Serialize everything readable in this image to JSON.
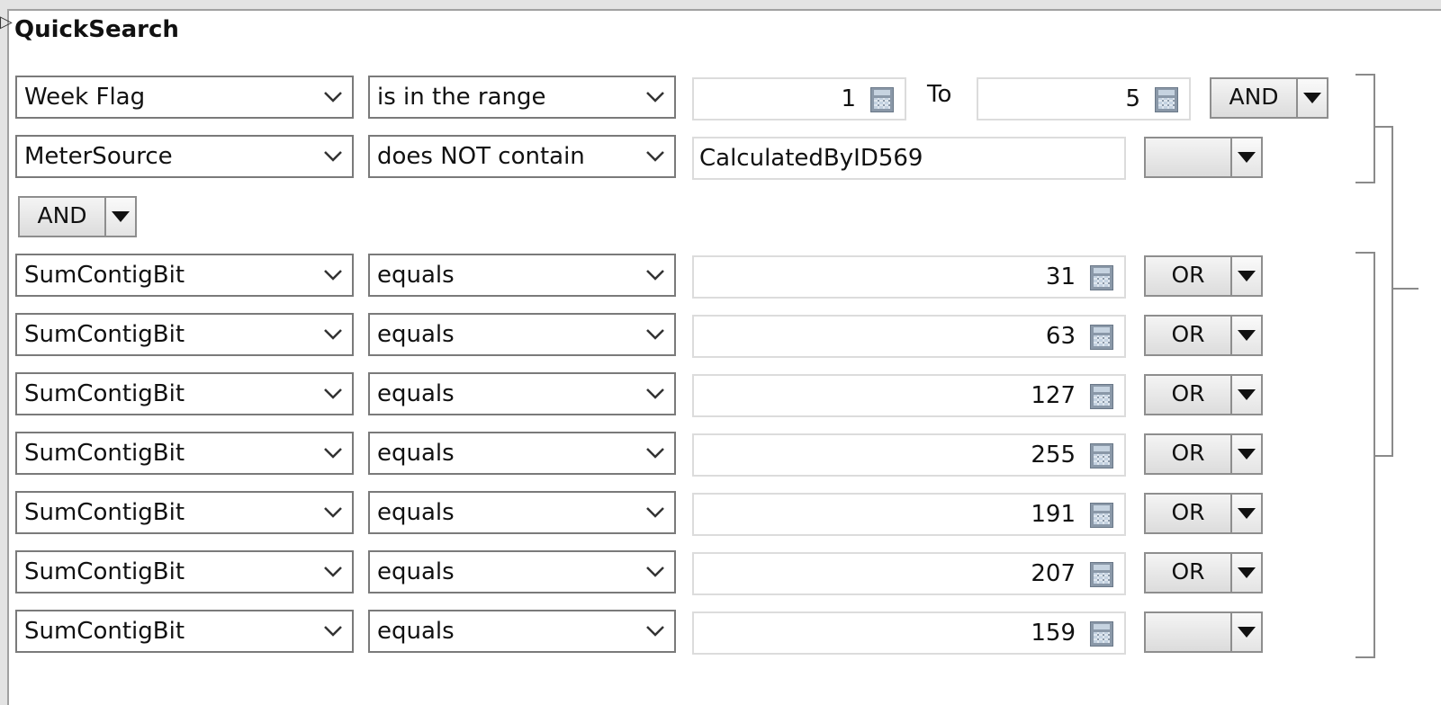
{
  "title": "QuickSearch",
  "icons": {
    "field_chevron": "chevron-down-icon",
    "calculator": "calculator-icon",
    "logic_arrow": "dropdown-arrow-icon"
  },
  "range_row": {
    "field": "Week Flag",
    "operator": "is in the range",
    "from_value": "1",
    "to_label": "To",
    "to_value": "5",
    "logic": "AND"
  },
  "text_row": {
    "field": "MeterSource",
    "operator": "does NOT contain",
    "value": "CalculatedByID569",
    "logic": ""
  },
  "group_logic": "AND",
  "rows": [
    {
      "field": "SumContigBit",
      "operator": "equals",
      "value": "31",
      "logic": "OR"
    },
    {
      "field": "SumContigBit",
      "operator": "equals",
      "value": "63",
      "logic": "OR"
    },
    {
      "field": "SumContigBit",
      "operator": "equals",
      "value": "127",
      "logic": "OR"
    },
    {
      "field": "SumContigBit",
      "operator": "equals",
      "value": "255",
      "logic": "OR"
    },
    {
      "field": "SumContigBit",
      "operator": "equals",
      "value": "191",
      "logic": "OR"
    },
    {
      "field": "SumContigBit",
      "operator": "equals",
      "value": "207",
      "logic": "OR"
    },
    {
      "field": "SumContigBit",
      "operator": "equals",
      "value": "159",
      "logic": ""
    }
  ]
}
